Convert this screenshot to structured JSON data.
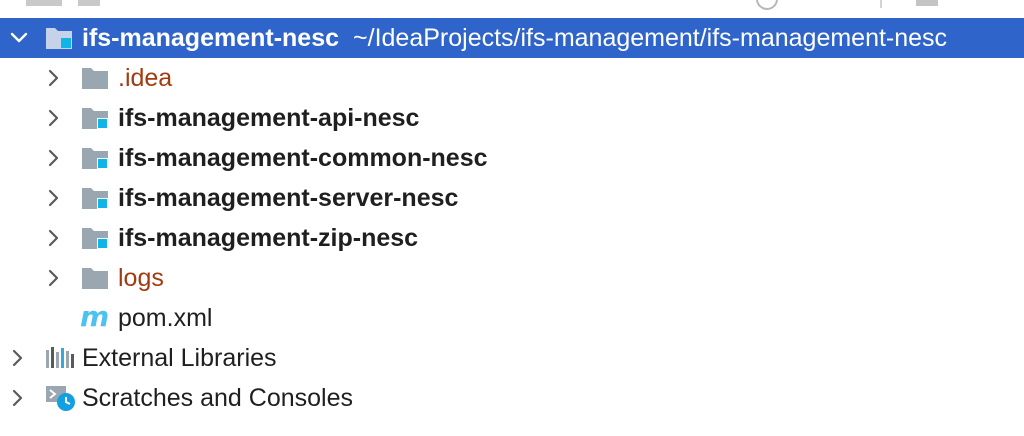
{
  "project_tree": {
    "root": {
      "name": "ifs-management-nesc",
      "path": "~/IdeaProjects/ifs-management/ifs-management-nesc",
      "expanded": true,
      "selected": true
    },
    "children": [
      {
        "name": ".idea",
        "type": "folder",
        "style": "excluded"
      },
      {
        "name": "ifs-management-api-nesc",
        "type": "module",
        "style": "bold"
      },
      {
        "name": "ifs-management-common-nesc",
        "type": "module",
        "style": "bold"
      },
      {
        "name": "ifs-management-server-nesc",
        "type": "module",
        "style": "bold"
      },
      {
        "name": "ifs-management-zip-nesc",
        "type": "module",
        "style": "bold"
      },
      {
        "name": "logs",
        "type": "folder",
        "style": "excluded"
      },
      {
        "name": "pom.xml",
        "type": "maven-file",
        "style": "normal"
      }
    ],
    "external_libraries": "External Libraries",
    "scratches": "Scratches and Consoles"
  },
  "colors": {
    "selection": "#2f65ca",
    "excluded_text": "#a33a11",
    "module_badge": "#12b4e8",
    "folder_gray": "#9aa7b0",
    "maven_icon": "#4ec2ee"
  },
  "icons": {
    "expand": "chevron-right-icon",
    "collapse": "chevron-down-icon",
    "folder": "folder-icon",
    "module": "module-folder-icon",
    "maven": "maven-m-icon",
    "libraries": "libraries-icon",
    "scratches": "scratches-icon"
  }
}
